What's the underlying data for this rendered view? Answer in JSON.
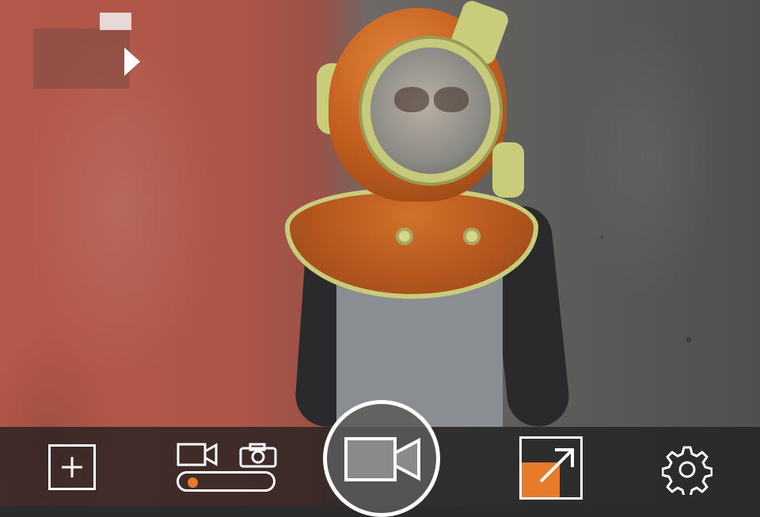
{
  "app": {
    "mode": "video",
    "accent_color": "#e87a2c"
  },
  "viewfinder": {
    "scene": "live-camera-preview"
  },
  "overlay": {
    "preview_thumbnail_icon": "thumbnail-panel",
    "arrow_icon": "play-right-icon"
  },
  "toolbar": {
    "add_icon": "plus-icon",
    "video_mode_icon": "video-camera-icon",
    "photo_mode_icon": "photo-camera-icon",
    "mode_switch_position": "video",
    "record_icon": "video-camera-icon",
    "expand_icon": "expand-arrow-icon",
    "settings_icon": "gear-icon"
  },
  "colors": {
    "toolbar_bg": "#202020",
    "icon_stroke": "#ffffff",
    "accent": "#e87a2c"
  }
}
